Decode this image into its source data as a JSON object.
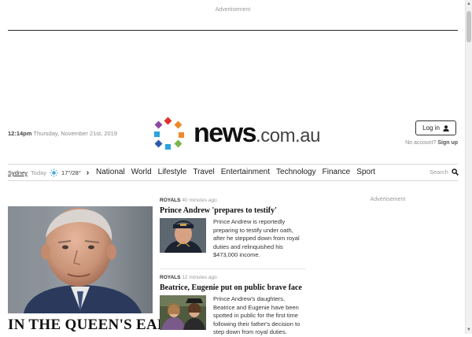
{
  "ads": {
    "top_label": "Advertisement",
    "right_label": "Advertisement"
  },
  "masthead": {
    "time": "12:14pm",
    "date": "Thursday, November 21st, 2019",
    "logo_word": "news",
    "logo_domain": ".com.au",
    "login_label": "Log in",
    "no_account_text": "No account?",
    "signup_label": "Sign up"
  },
  "weather": {
    "city": "Sydney",
    "day": "Today",
    "temps": "17°/28°",
    "icon": "sun-icon"
  },
  "nav": {
    "items": [
      "National",
      "World",
      "Lifestyle",
      "Travel",
      "Entertainment",
      "Technology",
      "Finance",
      "Sport"
    ],
    "search_label": "Search"
  },
  "hero": {
    "headline": "IN THE QUEEN'S EAR:"
  },
  "stories": [
    {
      "tag": "ROYALS",
      "time": "40 minutes ago",
      "title": "Prince Andrew 'prepares to testify'",
      "summary": "Prince Andrew is reportedly preparing to testify under oath, after he stepped down from royal duties and relinquished his $473,000 income."
    },
    {
      "tag": "ROYALS",
      "time": "12 minutes ago",
      "title": "Beatrice, Eugenie put on public brave face",
      "summary": "Prince Andrew's daughters, Beatrice and Eugenie have been spotted in public for the first time following their father's decision to step down from royal duties."
    }
  ],
  "colors": {
    "logo_dots": [
      "#e4312b",
      "#f0892a",
      "#7ab648",
      "#2aa4dc",
      "#2d5aa8",
      "#8b4aa0"
    ],
    "text_dark": "#111111",
    "meta_gray": "#9a9a9a"
  }
}
